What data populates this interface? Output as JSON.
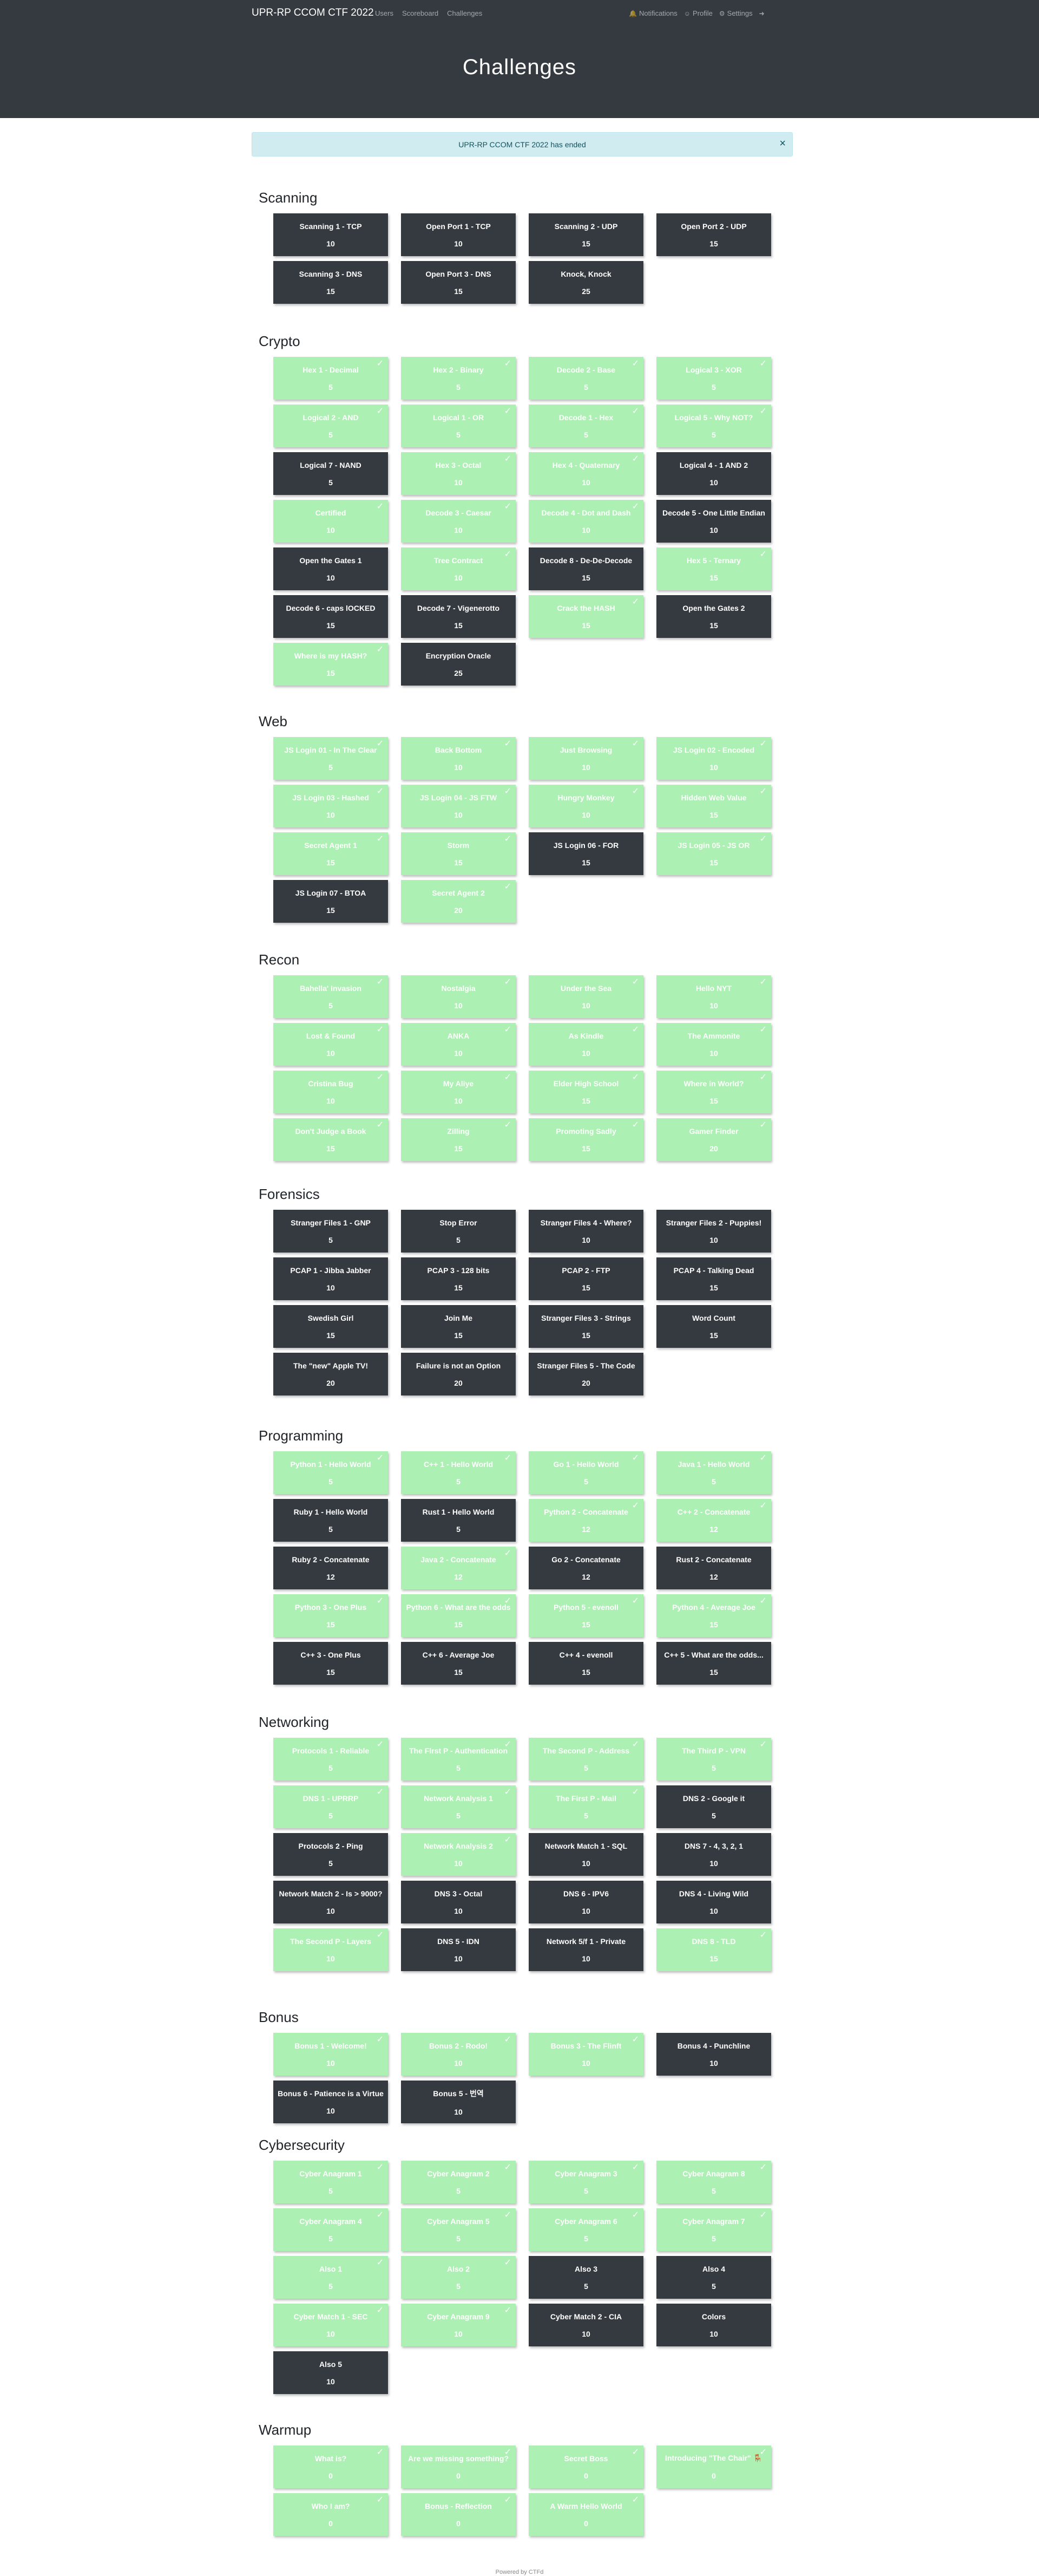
{
  "navbar": {
    "brand": "UPR-RP CCOM CTF 2022",
    "links": [
      "Users",
      "Scoreboard",
      "Challenges"
    ],
    "notifications": "Notifications",
    "profile": "Profile",
    "settings": "Settings"
  },
  "page_title": "Challenges",
  "alert": {
    "text": "UPR-RP CCOM CTF 2022 has ended",
    "close": "×"
  },
  "colors": {
    "solved": "#adf0b3",
    "unsolved": "#343a40",
    "header": "#343a40",
    "alert_bg": "#d1ecf1"
  },
  "categories": [
    {
      "title": "Scanning",
      "challenges": [
        {
          "name": "Scanning 1 - TCP",
          "points": "10",
          "solved": false
        },
        {
          "name": "Open Port 1 - TCP",
          "points": "10",
          "solved": false
        },
        {
          "name": "Scanning 2 - UDP",
          "points": "15",
          "solved": false
        },
        {
          "name": "Open Port 2 - UDP",
          "points": "15",
          "solved": false
        },
        {
          "name": "Scanning 3 - DNS",
          "points": "15",
          "solved": false
        },
        {
          "name": "Open Port 3 - DNS",
          "points": "15",
          "solved": false
        },
        {
          "name": "Knock, Knock",
          "points": "25",
          "solved": false
        }
      ]
    },
    {
      "title": "Crypto",
      "challenges": [
        {
          "name": "Hex 1 - Decimal",
          "points": "5",
          "solved": true
        },
        {
          "name": "Hex 2 - Binary",
          "points": "5",
          "solved": true
        },
        {
          "name": "Decode 2 - Base",
          "points": "5",
          "solved": true
        },
        {
          "name": "Logical 3 - XOR",
          "points": "5",
          "solved": true
        },
        {
          "name": "Logical 2 - AND",
          "points": "5",
          "solved": true
        },
        {
          "name": "Logical 1 - OR",
          "points": "5",
          "solved": true
        },
        {
          "name": "Decode 1 - Hex",
          "points": "5",
          "solved": true
        },
        {
          "name": "Logical 5 - Why NOT?",
          "points": "5",
          "solved": true
        },
        {
          "name": "Logical 7 - NAND",
          "points": "5",
          "solved": false
        },
        {
          "name": "Hex 3 - Octal",
          "points": "10",
          "solved": true
        },
        {
          "name": "Hex 4 - Quaternary",
          "points": "10",
          "solved": true
        },
        {
          "name": "Logical 4 - 1 AND 2",
          "points": "10",
          "solved": false
        },
        {
          "name": "Certified",
          "points": "10",
          "solved": true
        },
        {
          "name": "Decode 3 - Caesar",
          "points": "10",
          "solved": true
        },
        {
          "name": "Decode 4 - Dot and Dash",
          "points": "10",
          "solved": true
        },
        {
          "name": "Decode 5 - One Little Endian",
          "points": "10",
          "solved": false
        },
        {
          "name": "Open the Gates 1",
          "points": "10",
          "solved": false
        },
        {
          "name": "Tree Contract",
          "points": "10",
          "solved": true
        },
        {
          "name": "Decode 8 - De-De-Decode",
          "points": "15",
          "solved": false
        },
        {
          "name": "Hex 5 - Ternary",
          "points": "15",
          "solved": true
        },
        {
          "name": "Decode 6 - caps lOCKED",
          "points": "15",
          "solved": false
        },
        {
          "name": "Decode 7 - Vigenerotto",
          "points": "15",
          "solved": false
        },
        {
          "name": "Crack the HASH",
          "points": "15",
          "solved": true
        },
        {
          "name": "Open the Gates 2",
          "points": "15",
          "solved": false
        },
        {
          "name": "Where is my HASH?",
          "points": "15",
          "solved": true
        },
        {
          "name": "Encryption Oracle",
          "points": "25",
          "solved": false
        }
      ]
    },
    {
      "title": "Web",
      "challenges": [
        {
          "name": "JS Login 01 - In The Clear",
          "points": "5",
          "solved": true
        },
        {
          "name": "Back Bottom",
          "points": "10",
          "solved": true
        },
        {
          "name": "Just Browsing",
          "points": "10",
          "solved": true
        },
        {
          "name": "JS Login 02 - Encoded",
          "points": "10",
          "solved": true
        },
        {
          "name": "JS Login 03 - Hashed",
          "points": "10",
          "solved": true
        },
        {
          "name": "JS Login 04 - JS FTW",
          "points": "10",
          "solved": true
        },
        {
          "name": "Hungry Monkey",
          "points": "10",
          "solved": true
        },
        {
          "name": "Hidden Web Value",
          "points": "15",
          "solved": true
        },
        {
          "name": "Secret Agent 1",
          "points": "15",
          "solved": true
        },
        {
          "name": "Storm",
          "points": "15",
          "solved": true
        },
        {
          "name": "JS Login 06 - FOR",
          "points": "15",
          "solved": false
        },
        {
          "name": "JS Login 05 - JS OR",
          "points": "15",
          "solved": true
        },
        {
          "name": "JS Login 07 - BTOA",
          "points": "15",
          "solved": false
        },
        {
          "name": "Secret Agent 2",
          "points": "20",
          "solved": true
        }
      ]
    },
    {
      "title": "Recon",
      "challenges": [
        {
          "name": "Bahella' Invasion",
          "points": "5",
          "solved": true
        },
        {
          "name": "Nostalgia",
          "points": "10",
          "solved": true
        },
        {
          "name": "Under the Sea",
          "points": "10",
          "solved": true
        },
        {
          "name": "Hello NYT",
          "points": "10",
          "solved": true
        },
        {
          "name": "Lost & Found",
          "points": "10",
          "solved": true
        },
        {
          "name": "ANKA",
          "points": "10",
          "solved": true
        },
        {
          "name": "As Kindle",
          "points": "10",
          "solved": true
        },
        {
          "name": "The Ammonite",
          "points": "10",
          "solved": true
        },
        {
          "name": "Cristina Bug",
          "points": "10",
          "solved": true
        },
        {
          "name": "My Aliye",
          "points": "10",
          "solved": true
        },
        {
          "name": "Elder High School",
          "points": "15",
          "solved": true
        },
        {
          "name": "Where in World?",
          "points": "15",
          "solved": true
        },
        {
          "name": "Don't Judge a Book",
          "points": "15",
          "solved": true
        },
        {
          "name": "Zilling",
          "points": "15",
          "solved": true
        },
        {
          "name": "Promoting Sadly",
          "points": "15",
          "solved": true
        },
        {
          "name": "Gamer Finder",
          "points": "20",
          "solved": true
        }
      ]
    },
    {
      "title": "Forensics",
      "challenges": [
        {
          "name": "Stranger Files 1 - GNP",
          "points": "5",
          "solved": false
        },
        {
          "name": "Stop Error",
          "points": "5",
          "solved": false
        },
        {
          "name": "Stranger Files 4 - Where?",
          "points": "10",
          "solved": false
        },
        {
          "name": "Stranger Files 2 - Puppies!",
          "points": "10",
          "solved": false
        },
        {
          "name": "PCAP 1 - Jibba Jabber",
          "points": "10",
          "solved": false
        },
        {
          "name": "PCAP 3 - 128 bits",
          "points": "15",
          "solved": false
        },
        {
          "name": "PCAP 2 - FTP",
          "points": "15",
          "solved": false
        },
        {
          "name": "PCAP 4 - Talking Dead",
          "points": "15",
          "solved": false
        },
        {
          "name": "Swedish Girl",
          "points": "15",
          "solved": false
        },
        {
          "name": "Join Me",
          "points": "15",
          "solved": false
        },
        {
          "name": "Stranger Files 3 - Strings",
          "points": "15",
          "solved": false
        },
        {
          "name": "Word Count",
          "points": "15",
          "solved": false
        },
        {
          "name": "The \"new\" Apple TV!",
          "points": "20",
          "solved": false
        },
        {
          "name": "Failure is not an Option",
          "points": "20",
          "solved": false
        },
        {
          "name": "Stranger Files 5 - The Code",
          "points": "20",
          "solved": false
        }
      ]
    },
    {
      "title": "Programming",
      "challenges": [
        {
          "name": "Python 1 - Hello World",
          "points": "5",
          "solved": true
        },
        {
          "name": "C++ 1 - Hello World",
          "points": "5",
          "solved": true
        },
        {
          "name": "Go 1 - Hello World",
          "points": "5",
          "solved": true
        },
        {
          "name": "Java 1 - Hello World",
          "points": "5",
          "solved": true
        },
        {
          "name": "Ruby 1 - Hello World",
          "points": "5",
          "solved": false
        },
        {
          "name": "Rust 1 - Hello World",
          "points": "5",
          "solved": false
        },
        {
          "name": "Python 2 - Concatenate",
          "points": "12",
          "solved": true
        },
        {
          "name": "C++ 2 - Concatenate",
          "points": "12",
          "solved": true
        },
        {
          "name": "Ruby 2 - Concatenate",
          "points": "12",
          "solved": false
        },
        {
          "name": "Java 2 - Concatenate",
          "points": "12",
          "solved": true
        },
        {
          "name": "Go 2 - Concatenate",
          "points": "12",
          "solved": false
        },
        {
          "name": "Rust 2 - Concatenate",
          "points": "12",
          "solved": false
        },
        {
          "name": "Python 3 - One Plus",
          "points": "15",
          "solved": true
        },
        {
          "name": "Python 6 - What are the odds",
          "points": "15",
          "solved": true
        },
        {
          "name": "Python 5 - evenoll",
          "points": "15",
          "solved": true
        },
        {
          "name": "Python 4 - Average Joe",
          "points": "15",
          "solved": true
        },
        {
          "name": "C++ 3 - One Plus",
          "points": "15",
          "solved": false
        },
        {
          "name": "C++ 6 - Average Joe",
          "points": "15",
          "solved": false
        },
        {
          "name": "C++ 4 - evenoll",
          "points": "15",
          "solved": false
        },
        {
          "name": "C++ 5 - What are the odds...",
          "points": "15",
          "solved": false
        }
      ]
    },
    {
      "title": "Networking",
      "challenges": [
        {
          "name": "Protocols 1 - Reliable",
          "points": "5",
          "solved": true
        },
        {
          "name": "The Flrst P - Authentication",
          "points": "5",
          "solved": true
        },
        {
          "name": "The Second P - Address",
          "points": "5",
          "solved": true
        },
        {
          "name": "The Third P - VPN",
          "points": "5",
          "solved": true
        },
        {
          "name": "DNS 1 - UPRRP",
          "points": "5",
          "solved": true
        },
        {
          "name": "Network Analysis 1",
          "points": "5",
          "solved": true
        },
        {
          "name": "The First P - Mail",
          "points": "5",
          "solved": true
        },
        {
          "name": "DNS 2 - Google it",
          "points": "5",
          "solved": false
        },
        {
          "name": "Protocols 2 - Ping",
          "points": "5",
          "solved": false
        },
        {
          "name": "Network Analysis 2",
          "points": "10",
          "solved": true
        },
        {
          "name": "Network Match 1 - SQL",
          "points": "10",
          "solved": false
        },
        {
          "name": "DNS 7 - 4, 3, 2, 1",
          "points": "10",
          "solved": false
        },
        {
          "name": "Network Match 2 - Is > 9000?",
          "points": "10",
          "solved": false
        },
        {
          "name": "DNS 3 - Octal",
          "points": "10",
          "solved": false
        },
        {
          "name": "DNS 6 - IPV6",
          "points": "10",
          "solved": false
        },
        {
          "name": "DNS 4 - Living Wild",
          "points": "10",
          "solved": false
        },
        {
          "name": "The Second P - Layers",
          "points": "10",
          "solved": true
        },
        {
          "name": "DNS 5 - IDN",
          "points": "10",
          "solved": false
        },
        {
          "name": "Network 5/f 1 - Private",
          "points": "10",
          "solved": false
        },
        {
          "name": "DNS 8 - TLD",
          "points": "15",
          "solved": true
        }
      ]
    },
    {
      "title": "Bonus",
      "challenges": [
        {
          "name": "Bonus 1 - Welcome!",
          "points": "10",
          "solved": true
        },
        {
          "name": "Bonus 2 - Rodo!",
          "points": "10",
          "solved": true
        },
        {
          "name": "Bonus 3 - The Flinft",
          "points": "10",
          "solved": true
        },
        {
          "name": "Bonus 4 - Punchline",
          "points": "10",
          "solved": false
        },
        {
          "name": "Bonus 6 - Patience is a Virtue",
          "points": "10",
          "solved": false
        },
        {
          "name": "Bonus 5 - 번역",
          "points": "10",
          "solved": false
        }
      ]
    },
    {
      "title": "Cybersecurity",
      "challenges": [
        {
          "name": "Cyber Anagram 1",
          "points": "5",
          "solved": true
        },
        {
          "name": "Cyber Anagram 2",
          "points": "5",
          "solved": true
        },
        {
          "name": "Cyber Anagram 3",
          "points": "5",
          "solved": true
        },
        {
          "name": "Cyber Anagram 8",
          "points": "5",
          "solved": true
        },
        {
          "name": "Cyber Anagram 4",
          "points": "5",
          "solved": true
        },
        {
          "name": "Cyber Anagram 5",
          "points": "5",
          "solved": true
        },
        {
          "name": "Cyber Anagram 6",
          "points": "5",
          "solved": true
        },
        {
          "name": "Cyber Anagram 7",
          "points": "5",
          "solved": true
        },
        {
          "name": "Also 1",
          "points": "5",
          "solved": true
        },
        {
          "name": "Also 2",
          "points": "5",
          "solved": true
        },
        {
          "name": "Also 3",
          "points": "5",
          "solved": false
        },
        {
          "name": "Also 4",
          "points": "5",
          "solved": false
        },
        {
          "name": "Cyber Match 1 - SEC",
          "points": "10",
          "solved": true
        },
        {
          "name": "Cyber Anagram 9",
          "points": "10",
          "solved": true
        },
        {
          "name": "Cyber Match 2 - CIA",
          "points": "10",
          "solved": false
        },
        {
          "name": "Colors",
          "points": "10",
          "solved": false
        },
        {
          "name": "Also 5",
          "points": "10",
          "solved": false
        }
      ]
    },
    {
      "title": "Warmup",
      "challenges": [
        {
          "name": "What is?",
          "points": "0",
          "solved": true
        },
        {
          "name": "Are we missing something?",
          "points": "0",
          "solved": true
        },
        {
          "name": "Secret Boss",
          "points": "0",
          "solved": true
        },
        {
          "name": "Introducing \"The Chair\" 🪑",
          "points": "0",
          "solved": true
        },
        {
          "name": "Who I am?",
          "points": "0",
          "solved": true
        },
        {
          "name": "Bonus - Reflection",
          "points": "0",
          "solved": true
        },
        {
          "name": "A Warm Hello World",
          "points": "0",
          "solved": true
        }
      ]
    }
  ],
  "footer": "Powered by CTFd"
}
